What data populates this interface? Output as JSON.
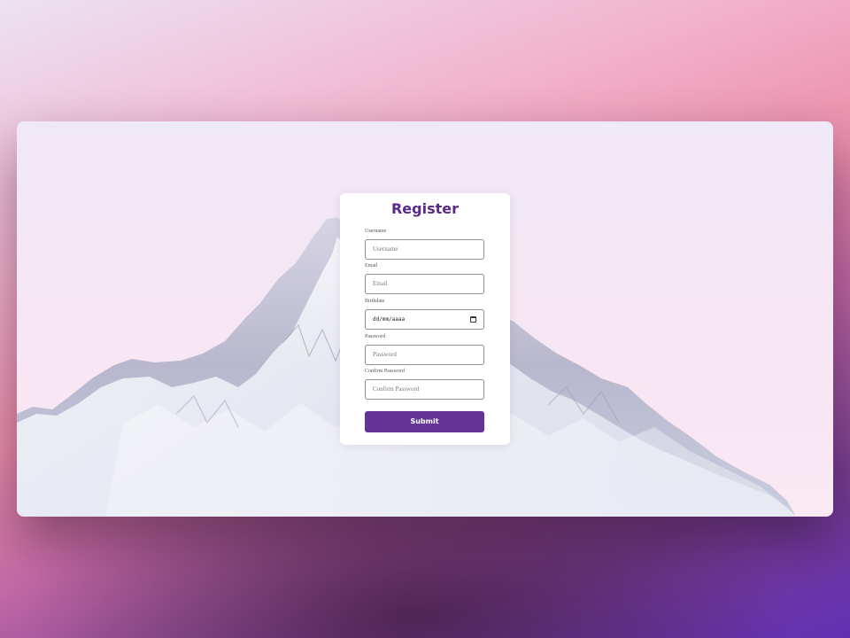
{
  "form": {
    "title": "Register",
    "fields": [
      {
        "label": "Username",
        "placeholder": "Username"
      },
      {
        "label": "Email",
        "placeholder": "Email"
      },
      {
        "label": "Birthdate",
        "placeholder": "dd/mm/aaaa"
      },
      {
        "label": "Password",
        "placeholder": "Password"
      },
      {
        "label": "Confirm Password",
        "placeholder": "Confirm Password"
      }
    ],
    "submit_label": "Submit"
  },
  "icons": {
    "date_picker": "calendar-icon"
  },
  "colors": {
    "accent": "#643596",
    "title": "#5a2a8a",
    "card_background": "#f3e8f5",
    "page_gradient_start": "#ece2f2",
    "page_gradient_end": "#6230b4"
  }
}
